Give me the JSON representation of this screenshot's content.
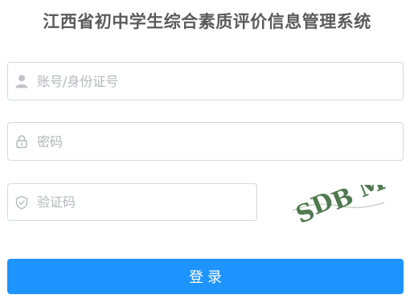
{
  "page": {
    "title": "江西省初中学生综合素质评价信息管理系统"
  },
  "form": {
    "account": {
      "placeholder": "账号/身份证号",
      "value": "",
      "icon": "user-icon"
    },
    "password": {
      "placeholder": "密码",
      "value": "",
      "icon": "lock-icon"
    },
    "captcha": {
      "placeholder": "验证码",
      "value": "",
      "icon": "shield-check-icon",
      "image_text": "SDB M"
    },
    "login_label": "登录"
  },
  "colors": {
    "primary": "#1e94ff",
    "title_text": "#5b5b5b",
    "placeholder": "#b4b7bd",
    "border": "#d6d8dd",
    "captcha_text": "#4f7a4f"
  }
}
